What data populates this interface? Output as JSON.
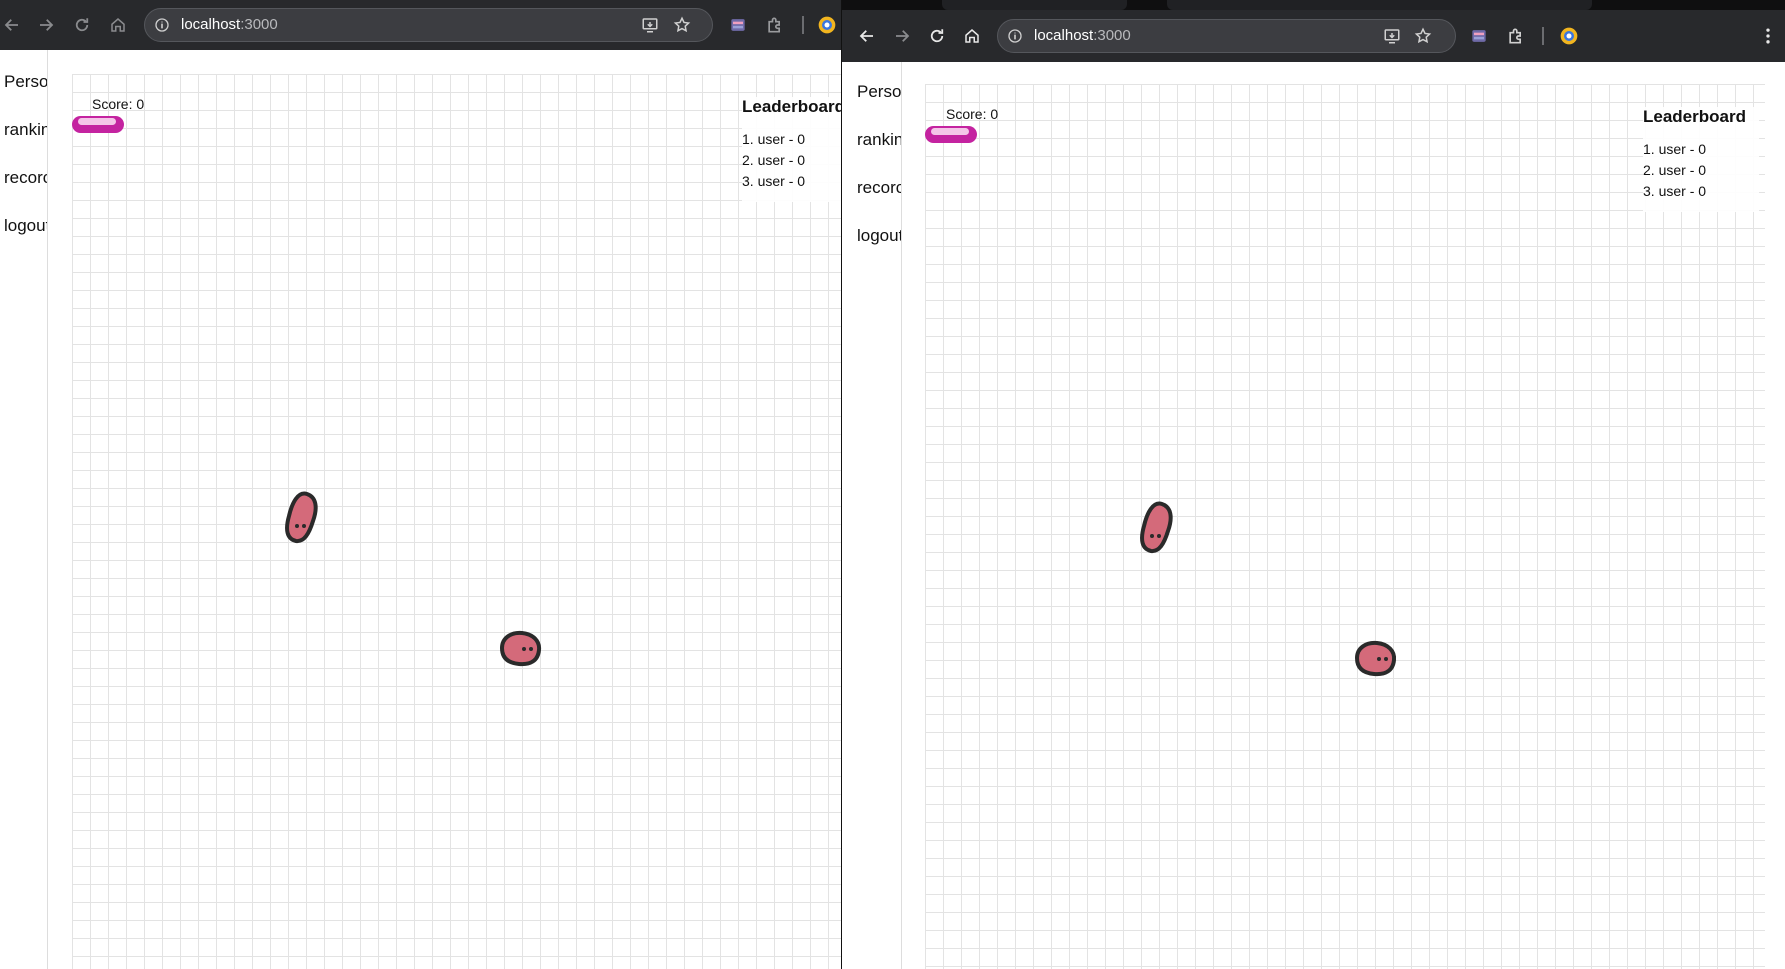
{
  "browser": {
    "url_host": "localhost",
    "url_port": ":3000"
  },
  "sidebar": {
    "items": [
      {
        "label": "Perso"
      },
      {
        "label": "rankin"
      },
      {
        "label": "recorc"
      },
      {
        "label": "logout"
      }
    ]
  },
  "game": {
    "score_label": "Score: 0",
    "leaderboard": {
      "title": "Leaderboard",
      "entries": [
        "1. user - 0",
        "2. user - 0",
        "3. user - 0"
      ]
    }
  },
  "colors": {
    "toolbar": "#28292c",
    "omnibox": "#3c3d41",
    "snake": "#c423a0",
    "creature_fill": "#d46a7a",
    "creature_outline": "#2a2a2a"
  }
}
